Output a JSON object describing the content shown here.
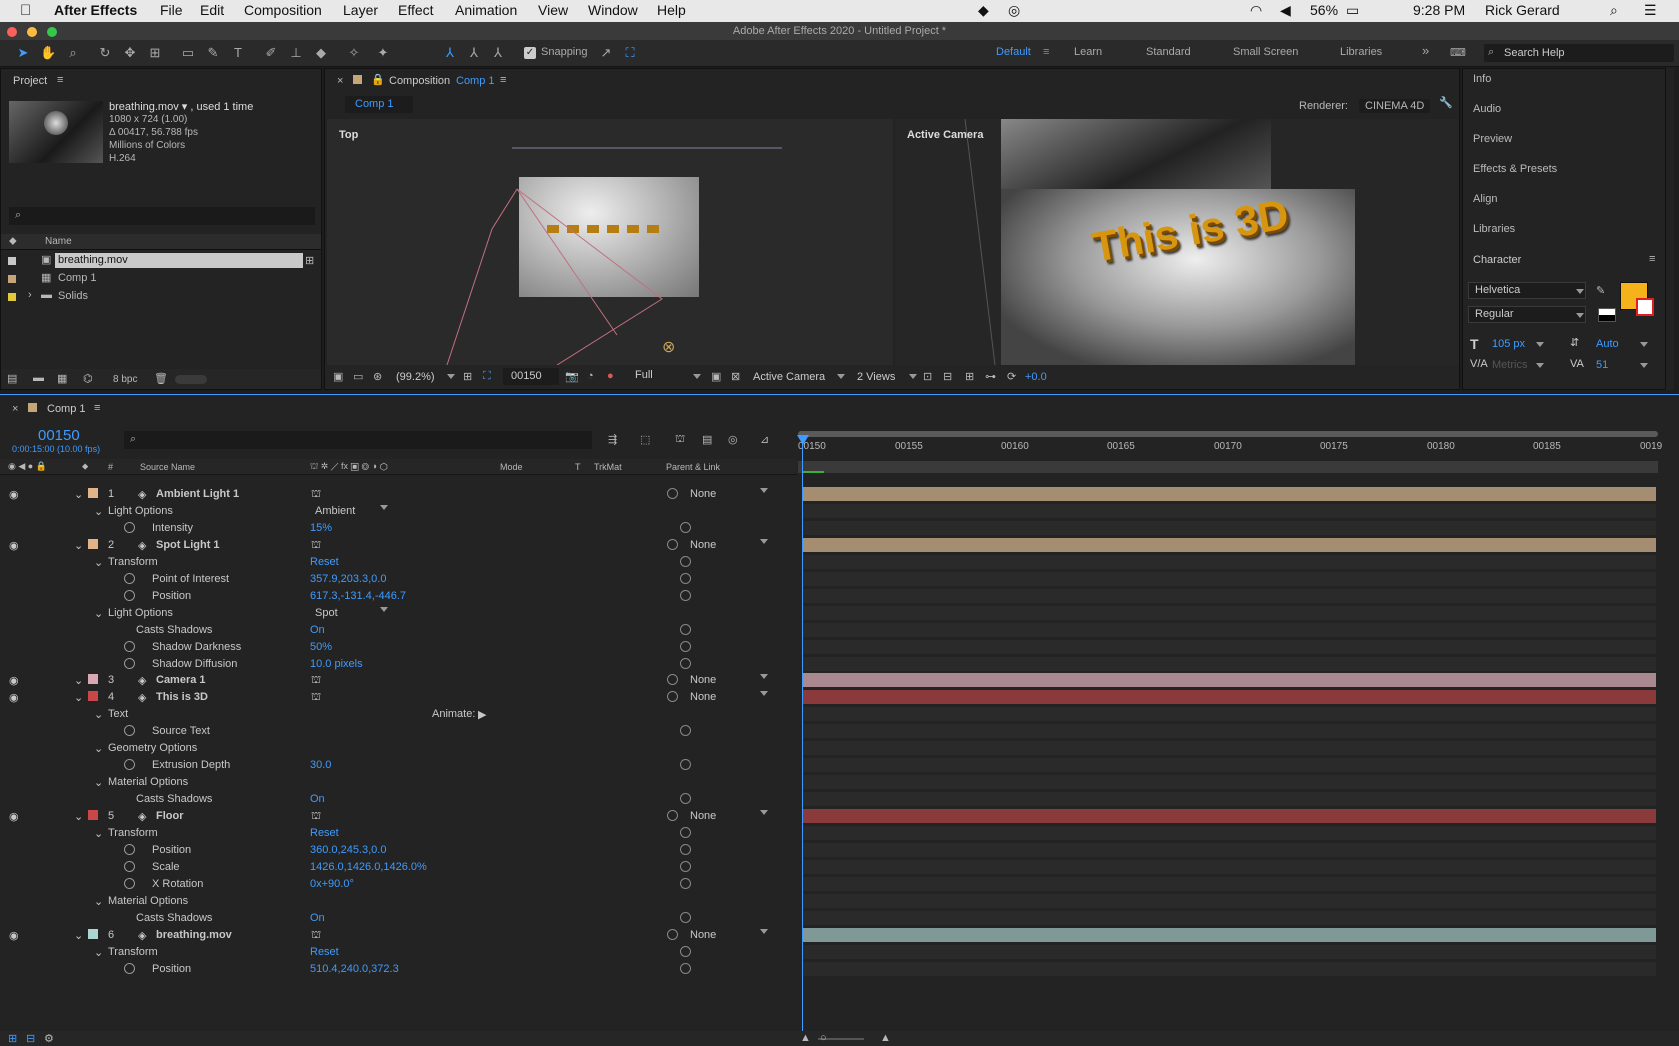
{
  "menubar": {
    "app": "After Effects",
    "items": [
      "File",
      "Edit",
      "Composition",
      "Layer",
      "Effect",
      "Animation",
      "View",
      "Window",
      "Help"
    ],
    "battery": "56%",
    "time": "9:28 PM",
    "user": "Rick Gerard"
  },
  "window_title": "Adobe After Effects 2020 - Untitled Project *",
  "toolbar": {
    "snapping_label": "Snapping",
    "workspaces": [
      "Default",
      "Learn",
      "Standard",
      "Small Screen",
      "Libraries"
    ],
    "search_placeholder": "Search Help"
  },
  "project": {
    "title": "Project",
    "footage_name": "breathing.mov ▾ , used 1 time",
    "footage_info": [
      "1080 x 724 (1.00)",
      "Δ 00417, 56.788 fps",
      "Millions of Colors",
      "H.264"
    ],
    "col_name": "Name",
    "items": [
      {
        "name": "breathing.mov",
        "color": "#c8c8c8"
      },
      {
        "name": "Comp 1",
        "color": "#c7a57a"
      },
      {
        "name": "Solids",
        "color": "#e2c73b"
      }
    ],
    "bpc": "8 bpc"
  },
  "comp_viewer": {
    "tab_prefix": "Composition",
    "tab_comp": "Comp 1",
    "subtab": "Comp 1",
    "renderer_label": "Renderer:",
    "renderer_value": "CINEMA 4D",
    "view_top": "Top",
    "view_active": "Active Camera",
    "render_text": "This is 3D",
    "zoom": "(99.2%)",
    "timecode": "00150",
    "resolution": "Full",
    "camera": "Active Camera",
    "views": "2 Views",
    "exposure": "+0.0"
  },
  "right_panel": {
    "items": [
      "Info",
      "Audio",
      "Preview",
      "Effects & Presets",
      "Align",
      "Libraries"
    ],
    "character_title": "Character",
    "font": "Helvetica",
    "style": "Regular",
    "size": "105 px",
    "leading": "Auto",
    "kerning": "Metrics",
    "tracking": "51",
    "fill_color": "#f6b21b"
  },
  "timeline": {
    "tab": "Comp 1",
    "timecode": "00150",
    "timecode_sub": "0:00:15:00 (10.00 fps)",
    "cols": {
      "num": "#",
      "source": "Source Name",
      "mode": "Mode",
      "t": "T",
      "trkmat": "TrkMat",
      "parent": "Parent & Link"
    },
    "ruler": [
      "00150",
      "00155",
      "00160",
      "00165",
      "00170",
      "00175",
      "00180",
      "00185",
      "0019"
    ],
    "animate_label": "Animate:",
    "rows": [
      {
        "kind": "layer",
        "num": "1",
        "name": "Ambient Light 1",
        "color": "#e0b488",
        "parent": "None",
        "bar": "#a48d71"
      },
      {
        "kind": "group",
        "label": "Light Options",
        "value": "Ambient",
        "dd": true
      },
      {
        "kind": "prop",
        "label": "Intensity",
        "value": "15%"
      },
      {
        "kind": "layer",
        "num": "2",
        "name": "Spot Light 1",
        "color": "#e0b488",
        "parent": "None",
        "bar": "#a48d71"
      },
      {
        "kind": "group",
        "label": "Transform",
        "value": "Reset"
      },
      {
        "kind": "prop",
        "label": "Point of Interest",
        "value": "357.9,203.3,0.0"
      },
      {
        "kind": "prop",
        "label": "Position",
        "value": "617.3,-131.4,-446.7"
      },
      {
        "kind": "group",
        "label": "Light Options",
        "value": "Spot",
        "dd": true
      },
      {
        "kind": "sub",
        "label": "Casts Shadows",
        "value": "On"
      },
      {
        "kind": "prop",
        "label": "Shadow Darkness",
        "value": "50%"
      },
      {
        "kind": "prop",
        "label": "Shadow Diffusion",
        "value": "10.0 pixels"
      },
      {
        "kind": "layer",
        "num": "3",
        "name": "Camera 1",
        "color": "#d9a6b3",
        "parent": "None",
        "bar": "#a98890"
      },
      {
        "kind": "layer",
        "num": "4",
        "name": "This is 3D",
        "color": "#c94747",
        "parent": "None",
        "bar": "#8a3a3a"
      },
      {
        "kind": "group",
        "label": "Text",
        "value": ""
      },
      {
        "kind": "prop",
        "label": "Source Text",
        "value": ""
      },
      {
        "kind": "group",
        "label": "Geometry Options",
        "value": ""
      },
      {
        "kind": "prop",
        "label": "Extrusion Depth",
        "value": "30.0"
      },
      {
        "kind": "group",
        "label": "Material Options",
        "value": ""
      },
      {
        "kind": "sub",
        "label": "Casts Shadows",
        "value": "On"
      },
      {
        "kind": "layer",
        "num": "5",
        "name": "Floor",
        "color": "#c94747",
        "parent": "None",
        "bar": "#8a3a3a"
      },
      {
        "kind": "group",
        "label": "Transform",
        "value": "Reset"
      },
      {
        "kind": "prop",
        "label": "Position",
        "value": "360.0,245.3,0.0"
      },
      {
        "kind": "prop",
        "label": "Scale",
        "value": "1426.0,1426.0,1426.0%"
      },
      {
        "kind": "prop",
        "label": "X Rotation",
        "value": "0x+90.0°"
      },
      {
        "kind": "group",
        "label": "Material Options",
        "value": ""
      },
      {
        "kind": "sub",
        "label": "Casts Shadows",
        "value": "On"
      },
      {
        "kind": "layer",
        "num": "6",
        "name": "breathing.mov",
        "color": "#a9d6d0",
        "parent": "None",
        "bar": "#7f9a96"
      },
      {
        "kind": "group",
        "label": "Transform",
        "value": "Reset"
      },
      {
        "kind": "prop",
        "label": "Position",
        "value": "510.4,240.0,372.3"
      }
    ]
  }
}
